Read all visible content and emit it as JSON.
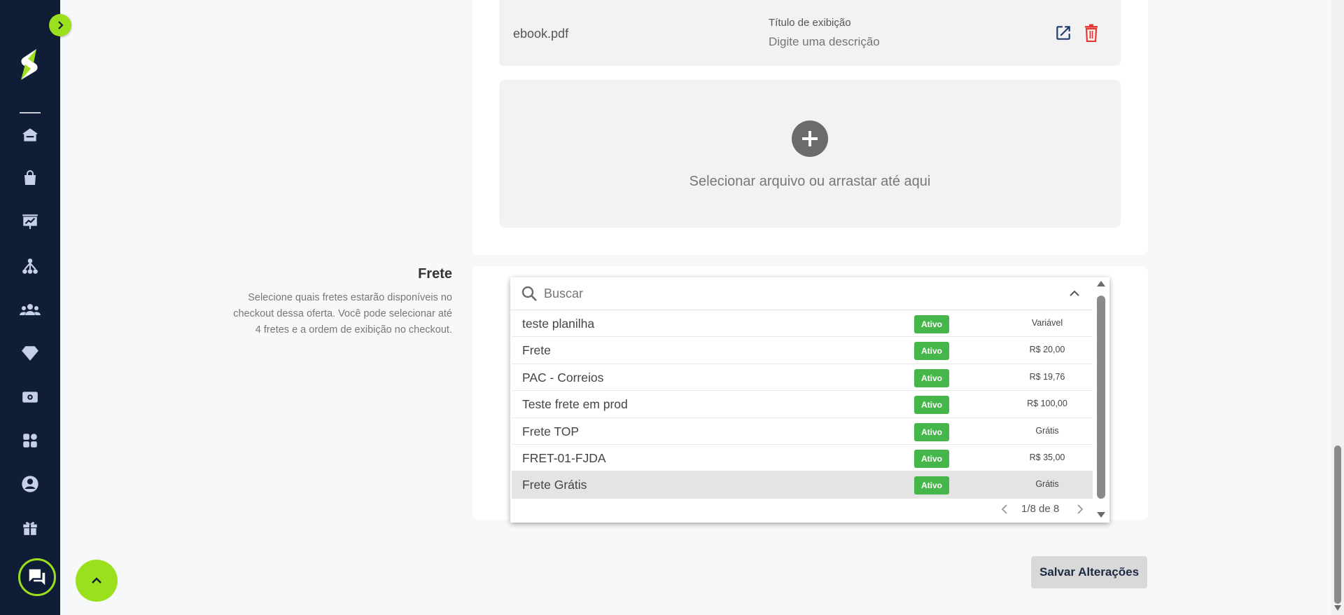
{
  "sidebar": {
    "nav_items": [
      {
        "icon": "home-icon"
      },
      {
        "icon": "shopping-bag-icon"
      },
      {
        "icon": "presentation-chart-icon"
      },
      {
        "icon": "network-icon"
      },
      {
        "icon": "users-group-icon"
      },
      {
        "icon": "diamond-icon"
      },
      {
        "icon": "cash-icon"
      },
      {
        "icon": "apps-grid-icon"
      },
      {
        "icon": "account-circle-icon"
      },
      {
        "icon": "gift-icon"
      }
    ]
  },
  "colors": {
    "sidebar_bg": "#0f1d36",
    "accent_green": "#9be01d",
    "badge_green": "#45b649",
    "delete_red": "#e53935"
  },
  "file": {
    "name": "ebook.pdf",
    "display_title_label": "Título de exibição",
    "display_title_placeholder": "Digite uma descrição"
  },
  "upload": {
    "text": "Selecionar arquivo ou arrastar até aqui"
  },
  "frete": {
    "title": "Frete",
    "description": "Selecione quais fretes estarão disponíveis no checkout dessa oferta. Você pode selecionar até 4 fretes e a ordem de exibição no checkout."
  },
  "dropdown": {
    "search_placeholder": "Buscar",
    "rows": [
      {
        "name": "teste planilha",
        "status": "Ativo",
        "price": "Variável"
      },
      {
        "name": "Frete",
        "status": "Ativo",
        "price": "R$ 20,00"
      },
      {
        "name": "PAC - Correios",
        "status": "Ativo",
        "price": "R$ 19,76"
      },
      {
        "name": "Teste frete em prod",
        "status": "Ativo",
        "price": "R$ 100,00"
      },
      {
        "name": "Frete TOP",
        "status": "Ativo",
        "price": "Grátis"
      },
      {
        "name": "FRET-01-FJDA",
        "status": "Ativo",
        "price": "R$ 35,00"
      },
      {
        "name": "Frete Grátis",
        "status": "Ativo",
        "price": "Grátis"
      }
    ],
    "pager": "1/8 de 8"
  },
  "save_button": "Salvar Alterações"
}
